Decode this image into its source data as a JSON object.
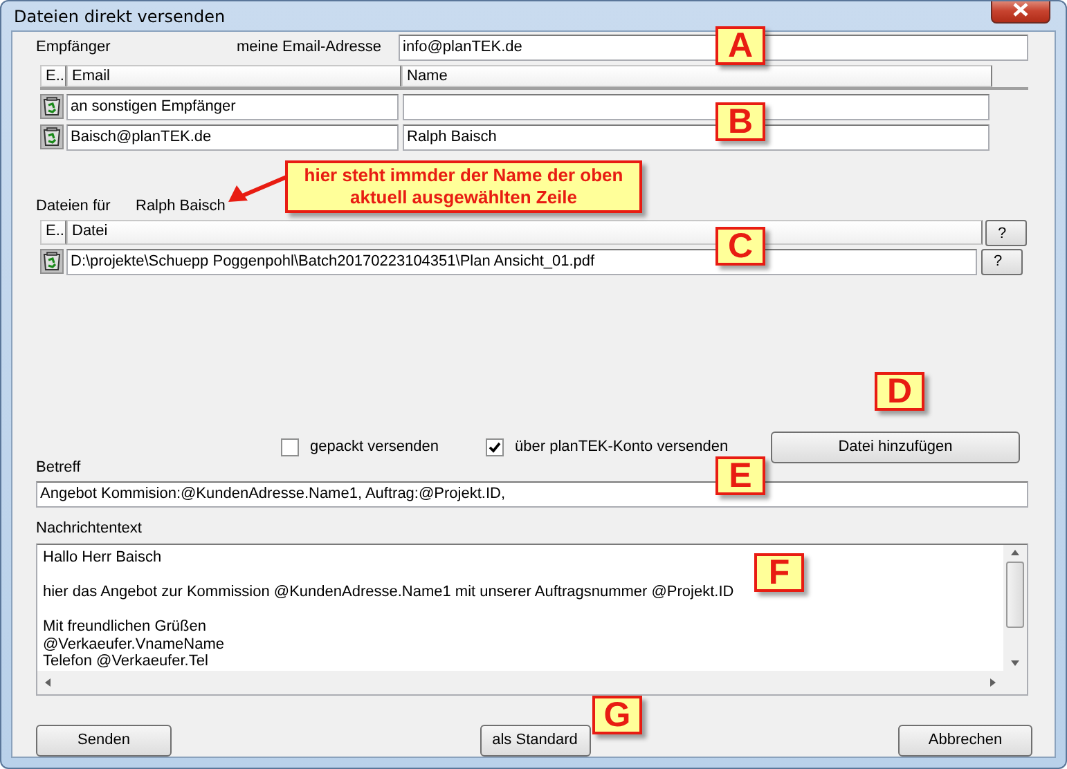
{
  "window": {
    "title": "Dateien direkt versenden"
  },
  "recipient_label": "Empfänger",
  "my_email_label": "meine Email-Adresse",
  "my_email": "info@planTEK.de",
  "recipients": {
    "columns": [
      "E..",
      "Email",
      "Name"
    ],
    "rows": [
      {
        "email": "an sonstigen Empfänger"
      },
      {
        "email": "Baisch@planTEK.de",
        "name": "Ralph Baisch"
      }
    ]
  },
  "files_label": "Dateien für",
  "files_for": "Ralph Baisch",
  "files": {
    "columns": [
      "E..",
      "Datei",
      "?"
    ],
    "rows": [
      {
        "path": "D:\\projekte\\Schuepp Poggenpohl\\Batch20170223104351\\Plan Ansicht_01.pdf",
        "button": "?"
      }
    ]
  },
  "options": [
    {
      "label": "gepackt versenden",
      "checked": false
    },
    {
      "label": "über planTEK-Konto versenden",
      "checked": true
    }
  ],
  "add_file_button": "Datei hinzufügen",
  "subject_label": "Betreff",
  "subject": "Angebot Kommision:@KundenAdresse.Name1,  Auftrag:@Projekt.ID,",
  "message_label": "Nachrichtentext",
  "message": "Hallo Herr Baisch\n\nhier das Angebot zur Kommission @KundenAdresse.Name1 mit unserer Auftragsnummer @Projekt.ID\n\nMit freundlichen Grüßen\n@Verkaeufer.VnameName\nTelefon @Verkaeufer.Tel",
  "buttons": [
    "Senden",
    "als Standard",
    "Abbrechen"
  ],
  "annotation_note": "hier steht immder der Name der oben aktuell ausgewählten Zeile",
  "callouts": [
    "A",
    "B",
    "C",
    "D",
    "E",
    "F",
    "G"
  ]
}
